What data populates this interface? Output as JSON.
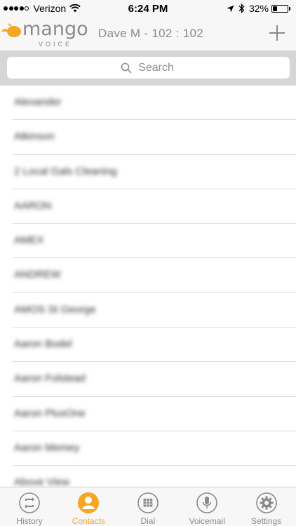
{
  "status_bar": {
    "carrier": "Verizon",
    "time": "6:24 PM",
    "battery_pct": "32%",
    "battery_level": 0.32,
    "signal_bars_filled": 4,
    "signal_bars_total": 5
  },
  "header": {
    "logo_word": "mango",
    "logo_sub": "VOICE",
    "user_title": "Dave M - 102 : 102"
  },
  "search": {
    "placeholder": "Search"
  },
  "contacts": [
    "Alexander",
    "Atkinson",
    "2 Local Gals Cleaning",
    "AARON",
    "AMEX",
    "ANDREW",
    "AMOS St George",
    "Aaron Bodel",
    "Aaron Folstead",
    "Aaron PlusOne",
    "Aaron Memey",
    "Above View"
  ],
  "tabs": [
    {
      "label": "History",
      "icon": "history-icon",
      "active": false
    },
    {
      "label": "Contacts",
      "icon": "contacts-icon",
      "active": true
    },
    {
      "label": "Dial",
      "icon": "dialpad-icon",
      "active": false
    },
    {
      "label": "Voicemail",
      "icon": "voicemail-icon",
      "active": false
    },
    {
      "label": "Settings",
      "icon": "settings-icon",
      "active": false
    }
  ],
  "colors": {
    "accent": "#f5a623",
    "inactive": "#8a8a8a",
    "bar_bg": "#f7f7f7",
    "search_bg": "#d6d6d6"
  }
}
